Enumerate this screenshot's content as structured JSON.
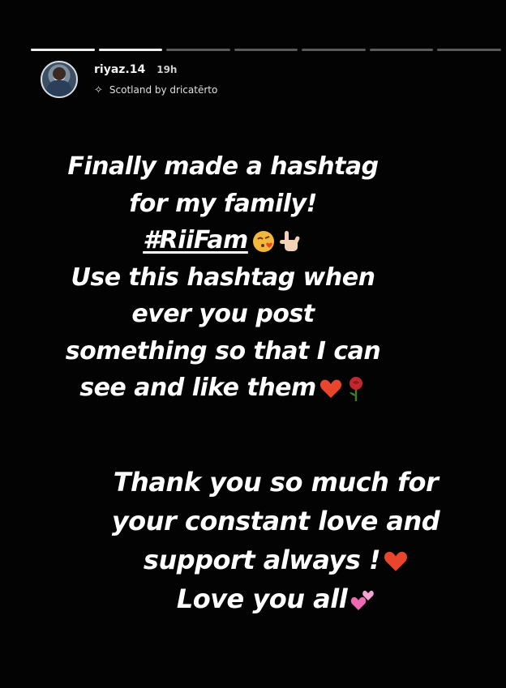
{
  "progress": {
    "segments": 7,
    "active_index": 0,
    "active_fill": 1.0
  },
  "header": {
    "username": "riyaz.14",
    "time": "19h",
    "music": "Scotland by dricatērto"
  },
  "message1": {
    "line1": "Finally made a hashtag",
    "line2": "for my family!",
    "hashtag": "#RiiFam",
    "line4": "Use this hashtag when",
    "line5": "ever you post",
    "line6": "something so that I can",
    "line7": "see and like them"
  },
  "message2": {
    "line1": "Thank you so much for",
    "line2": "your constant love and",
    "line3": "support always !",
    "line4": "Love you all"
  },
  "colors": {
    "background": "#000000",
    "text": "#ffffff",
    "heart": "#e8452c",
    "rose": "#c4262e",
    "pink_hearts": "#f068b4"
  },
  "icons": {
    "music": "sparkle-music-icon",
    "emoji_kiss": "kissing-face-emoji",
    "emoji_hand": "rock-on-hand-emoji",
    "emoji_heart": "red-heart-emoji",
    "emoji_rose": "rose-emoji",
    "emoji_two_hearts": "two-hearts-emoji"
  }
}
